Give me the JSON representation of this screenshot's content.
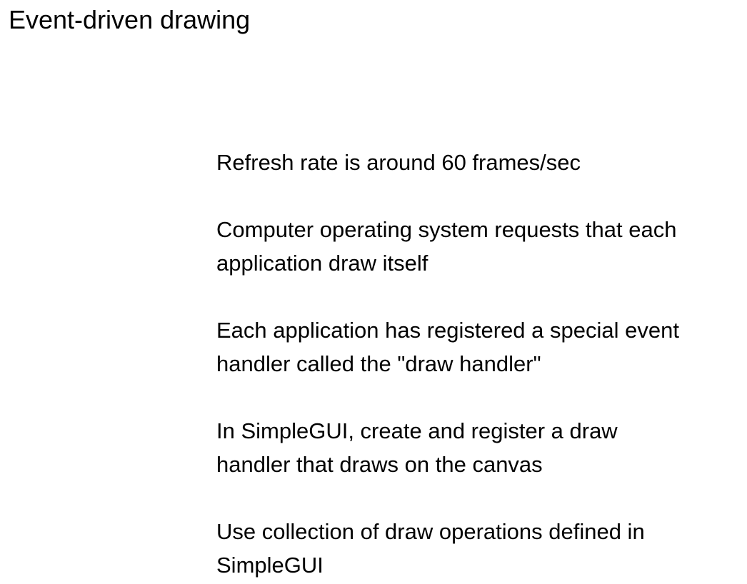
{
  "slide": {
    "title": "Event-driven drawing",
    "bullets": [
      {
        "lines": [
          "Refresh rate is around 60 frames/sec"
        ]
      },
      {
        "lines": [
          "Computer operating system requests that each",
          "application draw itself"
        ]
      },
      {
        "lines": [
          "Each application has registered a special event",
          "handler called the \"draw handler\""
        ]
      },
      {
        "lines": [
          "In SimpleGUI, create and register a draw",
          "handler that draws on the canvas"
        ]
      },
      {
        "lines": [
          "Use collection of draw operations defined in",
          "SimpleGUI"
        ]
      }
    ]
  }
}
